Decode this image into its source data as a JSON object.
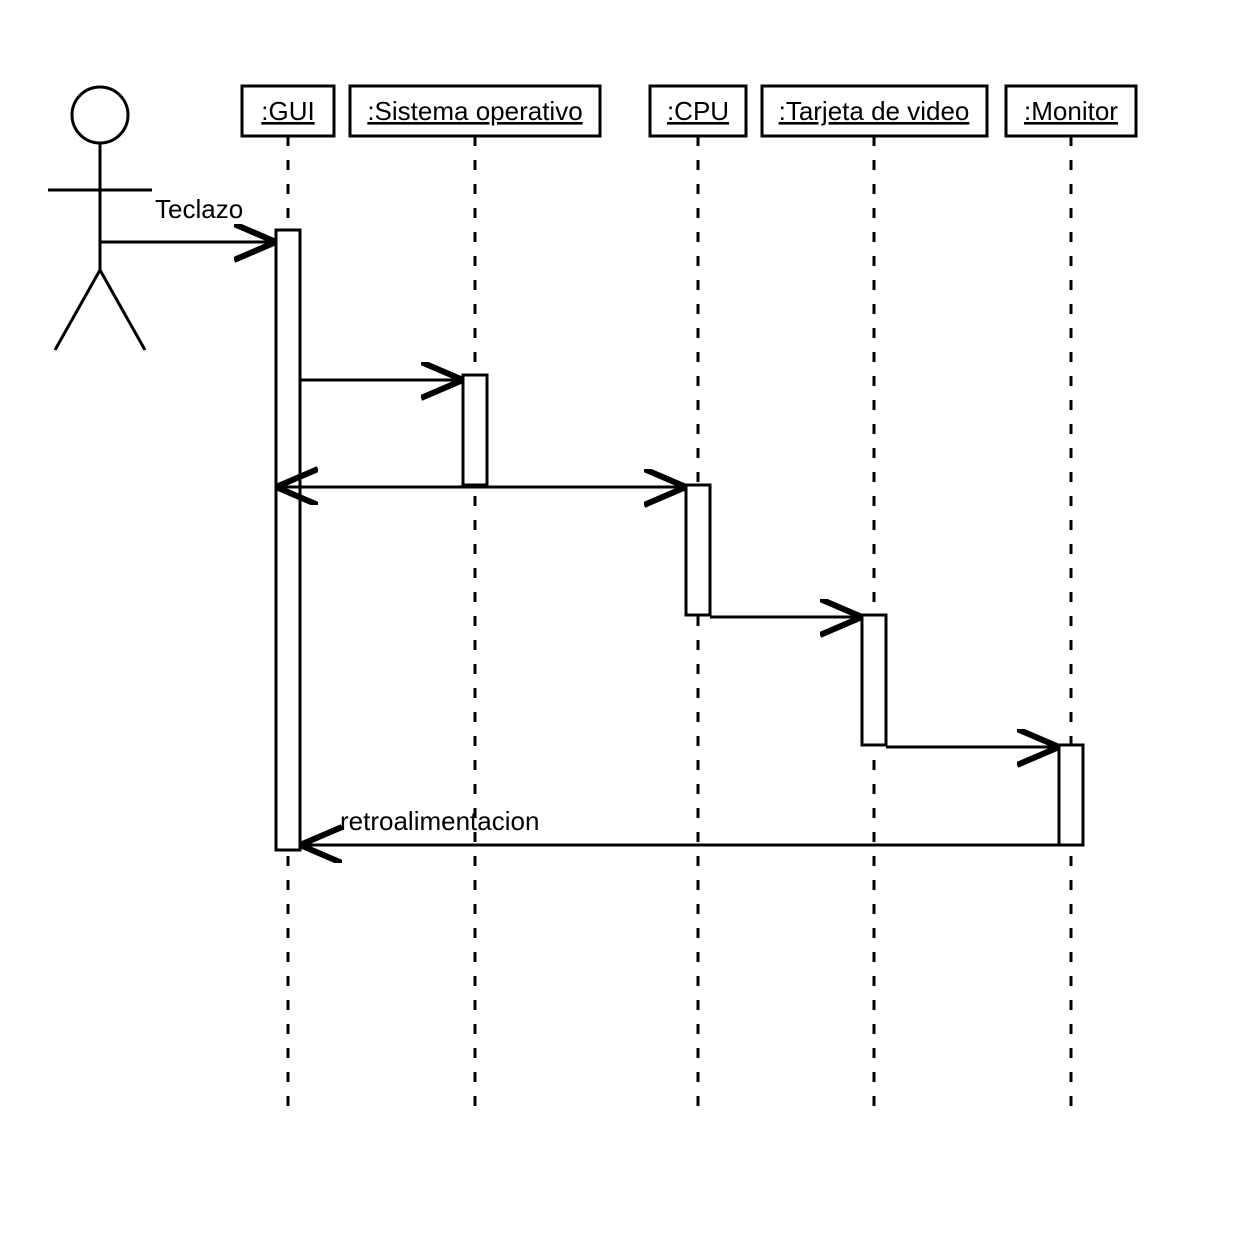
{
  "diagram": {
    "type": "uml-sequence",
    "actor": "user",
    "participants": [
      {
        "id": "gui",
        "label": ":GUI"
      },
      {
        "id": "os",
        "label": ":Sistema operativo"
      },
      {
        "id": "cpu",
        "label": ":CPU"
      },
      {
        "id": "video",
        "label": ":Tarjeta de video"
      },
      {
        "id": "monitor",
        "label": ":Monitor"
      }
    ],
    "messages": {
      "teclazo": "Teclazo",
      "feedback": "retroalimentacion"
    }
  }
}
